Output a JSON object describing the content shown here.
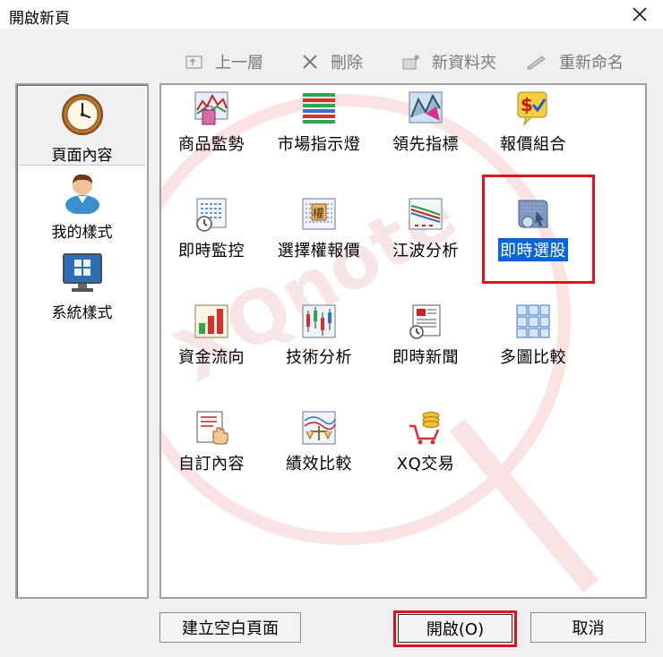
{
  "window": {
    "title": "開啟新頁"
  },
  "toolbar": {
    "up_label": "上一層",
    "delete_label": "刪除",
    "new_folder_label": "新資料夾",
    "rename_label": "重新命名"
  },
  "sidebar": {
    "items": [
      {
        "label": "頁面內容",
        "icon": "clock-icon"
      },
      {
        "label": "我的樣式",
        "icon": "user-icon"
      },
      {
        "label": "系統樣式",
        "icon": "monitor-windows-icon"
      }
    ]
  },
  "grid": {
    "items": [
      {
        "label": "商品監勢",
        "icon": "monitor-chart-icon"
      },
      {
        "label": "市場指示燈",
        "icon": "indicator-bars-icon"
      },
      {
        "label": "領先指標",
        "icon": "leading-indicator-icon"
      },
      {
        "label": "報價組合",
        "icon": "quote-bundle-icon"
      },
      {
        "label": "即時監控",
        "icon": "realtime-monitor-icon"
      },
      {
        "label": "選擇權報價",
        "icon": "options-quote-icon"
      },
      {
        "label": "江波分析",
        "icon": "wave-analysis-icon"
      },
      {
        "label": "即時選股",
        "icon": "stock-picker-icon"
      },
      {
        "label": "資金流向",
        "icon": "money-flow-icon"
      },
      {
        "label": "技術分析",
        "icon": "candlestick-icon"
      },
      {
        "label": "即時新聞",
        "icon": "news-icon"
      },
      {
        "label": "多圖比較",
        "icon": "multi-chart-icon"
      },
      {
        "label": "自訂內容",
        "icon": "custom-content-icon"
      },
      {
        "label": "績效比較",
        "icon": "performance-icon"
      },
      {
        "label": "XQ交易",
        "icon": "cart-coins-icon"
      }
    ],
    "selected_label": "即時選股"
  },
  "watermark": {
    "text": "XQnote"
  },
  "buttons": {
    "create_blank_label": "建立空白頁面",
    "open_label": "開啟(O)",
    "cancel_label": "取消"
  },
  "colors": {
    "selection": "#0a64d8",
    "highlight": "#e0141c",
    "watermark": "#f4c7c7"
  }
}
